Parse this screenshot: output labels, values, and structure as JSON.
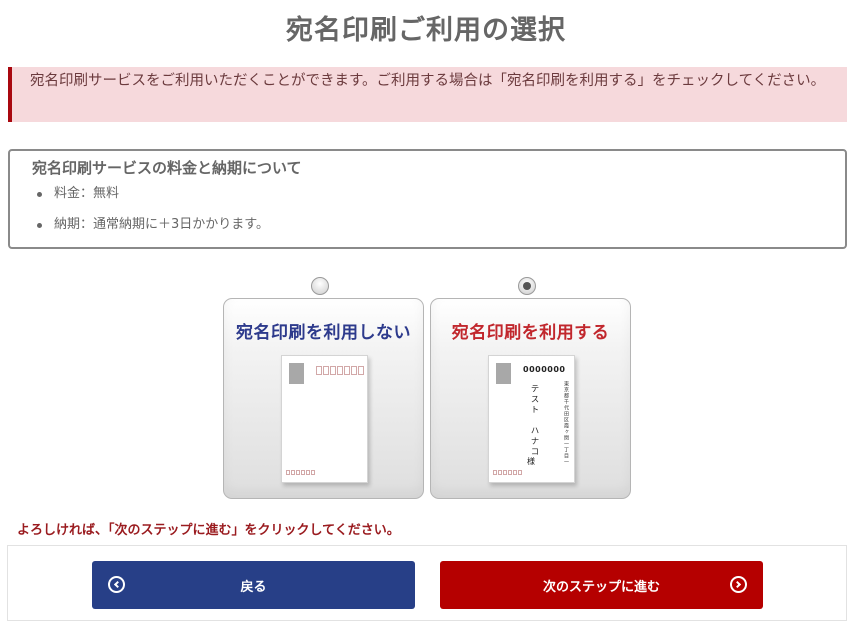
{
  "page": {
    "title": "宛名印刷ご利用の選択",
    "notice": "宛名印刷サービスをご利用いただくことができます。ご利用する場合は「宛名印刷を利用する」をチェックしてください。"
  },
  "info": {
    "title": "宛名印刷サービスの料金と納期について",
    "items": [
      "料金：無料",
      "納期：通常納期に＋3日かかります。"
    ]
  },
  "options": [
    {
      "label": "宛名印刷を利用しない",
      "selected": false,
      "title_color": "#2d3a8c"
    },
    {
      "label": "宛名印刷を利用する",
      "selected": true,
      "title_color": "#c1272d",
      "sample": {
        "zip": "0000000",
        "address": "東京都千代田区霞ヶ関一丁目一",
        "name": "テスト　ハナコ",
        "honorific": "様"
      }
    }
  ],
  "confirm_text": "よろしければ、「次のステップに進む」をクリックしてください。",
  "buttons": {
    "back_label": "戻る",
    "back_color": "#273f87",
    "next_label": "次のステップに進む",
    "next_color": "#b50000"
  },
  "icons": {
    "back": "chevron-left-circle-icon",
    "next": "chevron-right-circle-icon"
  }
}
